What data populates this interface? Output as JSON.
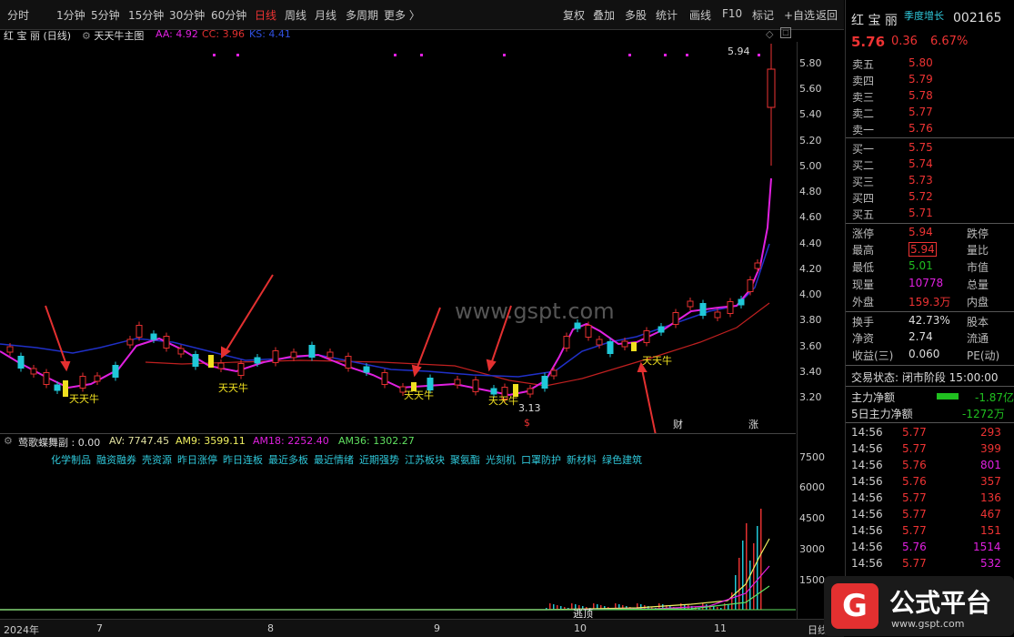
{
  "toolbar": {
    "timeframes": [
      "分时",
      "1分钟",
      "5分钟",
      "15分钟",
      "30分钟",
      "60分钟",
      "日线",
      "周线",
      "月线",
      "多周期",
      "更多 〉"
    ],
    "active_timeframe": "日线",
    "right_buttons": [
      "复权",
      "叠加",
      "多股",
      "统计",
      "画线",
      "F10",
      "标记",
      "+自选",
      "返回"
    ]
  },
  "title": {
    "stock": "红 宝 丽 (日线)",
    "indicator": "天天牛主图",
    "aa": "AA: 4.92",
    "cc": "CC: 3.96",
    "ks": "KS: 4.41",
    "high_label": "5.94",
    "low_label": "3.13",
    "signal_label": "天天牛"
  },
  "price_axis": [
    "5.80",
    "5.60",
    "5.40",
    "5.20",
    "5.00",
    "4.80",
    "4.60",
    "4.40",
    "4.20",
    "4.00",
    "3.80",
    "3.60",
    "3.40",
    "3.20"
  ],
  "sub": {
    "name": "莺歌蝶舞副 : 0.00",
    "av": "AV: 7747.45",
    "am9": "AM9: 3599.11",
    "am18": "AM18: 2252.40",
    "am36": "AM36: 1302.27",
    "tags": [
      "化学制品",
      "融资融券",
      "壳资源",
      "昨日涨停",
      "昨日连板",
      "最近多板",
      "最近情绪",
      "近期强势",
      "江苏板块",
      "聚氨酯",
      "光刻机",
      "口罩防护",
      "新材料",
      "绿色建筑"
    ],
    "axis": [
      "7500",
      "6000",
      "4500",
      "3000",
      "1500"
    ],
    "marker": "逃顶"
  },
  "dates": [
    "2024年",
    "7",
    "8",
    "9",
    "10",
    "11",
    "日线"
  ],
  "badges": {
    "s": "$",
    "cai": "财",
    "zhang": "涨"
  },
  "panel": {
    "name": "红 宝 丽",
    "tag": "季度增长",
    "code": "002165",
    "price": "5.76",
    "change": "0.36",
    "pct": "6.67%",
    "asks": [
      [
        "卖五",
        "5.80"
      ],
      [
        "卖四",
        "5.79"
      ],
      [
        "卖三",
        "5.78"
      ],
      [
        "卖二",
        "5.77"
      ],
      [
        "卖一",
        "5.76"
      ]
    ],
    "bids": [
      [
        "买一",
        "5.75"
      ],
      [
        "买二",
        "5.74"
      ],
      [
        "买三",
        "5.73"
      ],
      [
        "买四",
        "5.72"
      ],
      [
        "买五",
        "5.71"
      ]
    ],
    "stats": [
      [
        "涨停",
        "5.94",
        "跌停"
      ],
      [
        "最高",
        "5.94",
        "量比"
      ],
      [
        "最低",
        "5.01",
        "市值"
      ],
      [
        "现量",
        "10778",
        "总量"
      ],
      [
        "外盘",
        "159.3万",
        "内盘"
      ],
      [
        "换手",
        "42.73%",
        "股本"
      ],
      [
        "净资",
        "2.74",
        "流通"
      ],
      [
        "收益(三)",
        "0.060",
        "PE(动)"
      ]
    ],
    "trade_status": "交易状态: 闭市阶段 15:00:00",
    "main_net_label": "主力净额",
    "main_net_value": "-1.87亿",
    "net5_label": "5日主力净额",
    "net5_value": "-1272万",
    "ticks": [
      [
        "14:56",
        "5.77",
        "293"
      ],
      [
        "14:56",
        "5.77",
        "399"
      ],
      [
        "14:56",
        "5.76",
        "801"
      ],
      [
        "14:56",
        "5.76",
        "357"
      ],
      [
        "14:56",
        "5.77",
        "136"
      ],
      [
        "14:56",
        "5.77",
        "467"
      ],
      [
        "14:56",
        "5.77",
        "151"
      ],
      [
        "14:56",
        "5.76",
        "1514"
      ],
      [
        "14:56",
        "5.77",
        "532"
      ]
    ]
  },
  "watermark": "www.gspt.com",
  "logo": {
    "text": "公式平台",
    "url": "www.gspt.com"
  },
  "colors": {
    "up": "#e33030",
    "down": "#20c8d8",
    "ma_magenta": "#e020e0",
    "ma_blue": "#2030c8",
    "ma_red": "#c02020",
    "signal": "#f0e020"
  }
}
